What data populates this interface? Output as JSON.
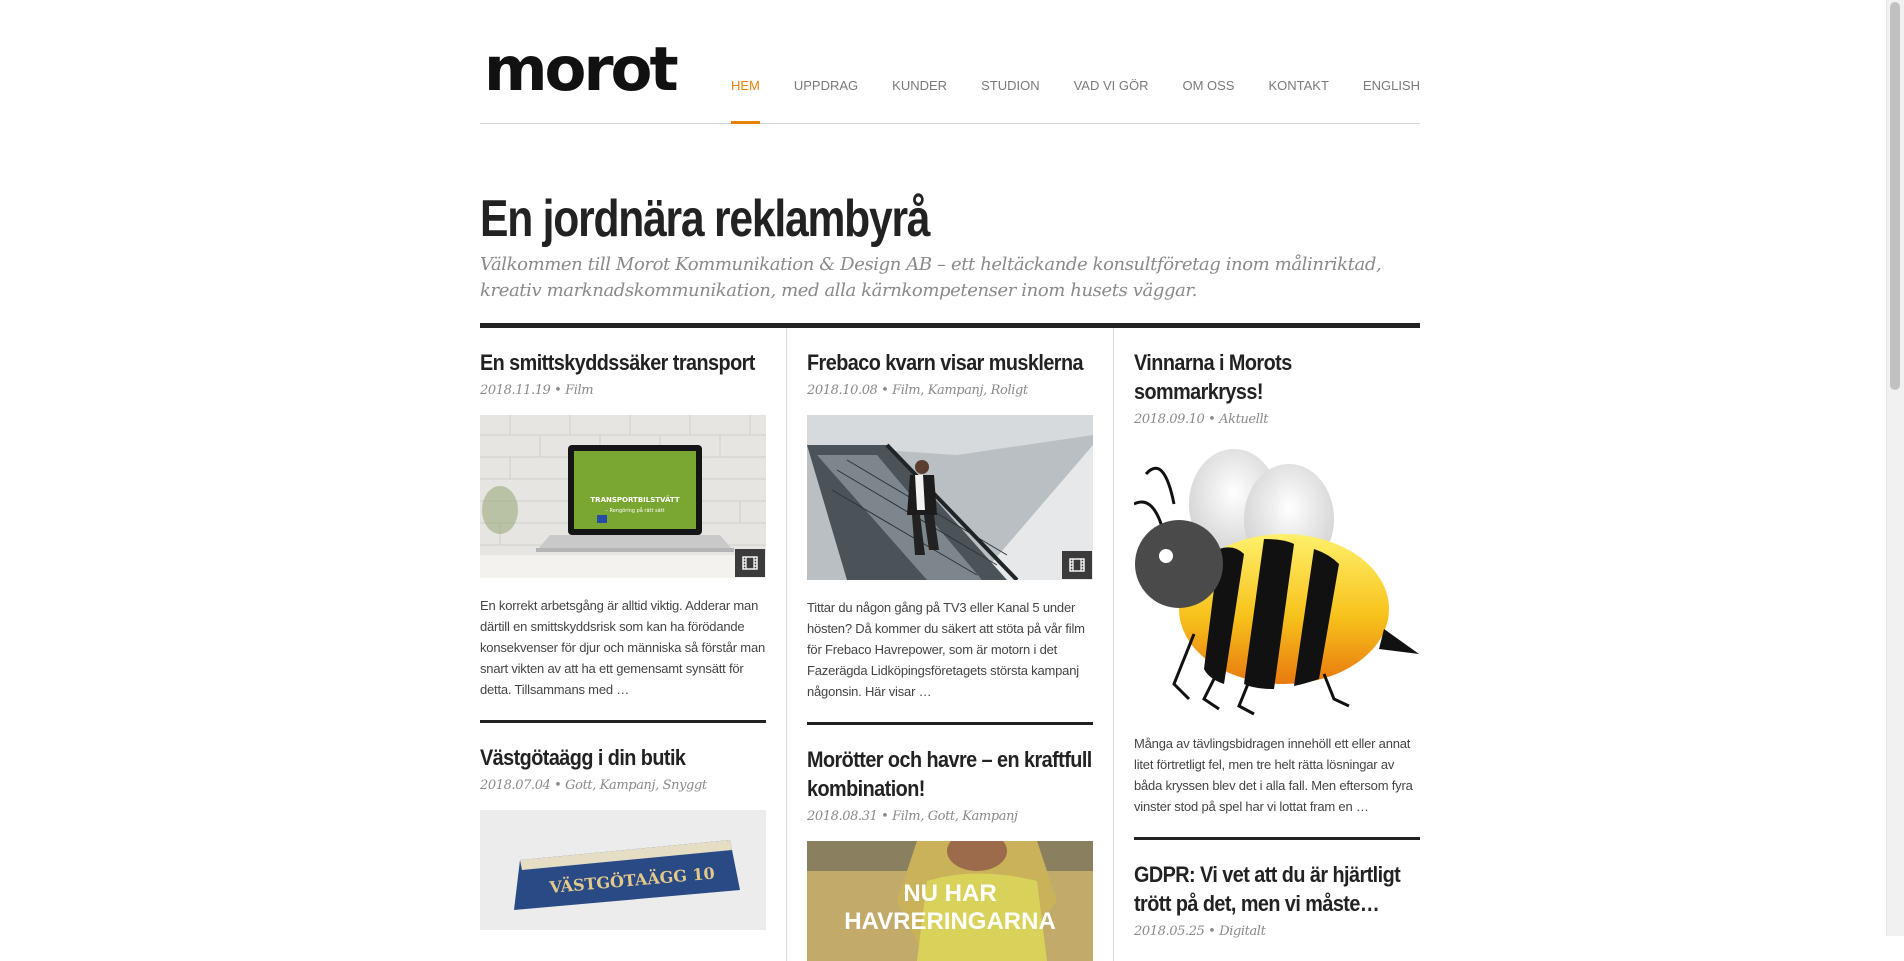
{
  "site": {
    "logo_text": "morot"
  },
  "nav": {
    "items": [
      {
        "label": "HEM",
        "active": true
      },
      {
        "label": "UPPDRAG",
        "active": false
      },
      {
        "label": "KUNDER",
        "active": false
      },
      {
        "label": "STUDION",
        "active": false
      },
      {
        "label": "VAD VI GÖR",
        "active": false
      },
      {
        "label": "OM OSS",
        "active": false
      },
      {
        "label": "KONTAKT",
        "active": false
      },
      {
        "label": "ENGLISH",
        "active": false
      }
    ],
    "accent_color": "#e8800c"
  },
  "hero": {
    "title": "En jordnära reklambyrå",
    "intro": "Välkommen till Morot Kommunikation & Design AB – ett heltäckande konsultföretag inom målinriktad, kreativ marknadskommunikation, med alla kärnkompetenser inom husets väggar."
  },
  "columns": [
    {
      "posts": [
        {
          "title": "En smittskyddssäker transport",
          "date": "2018.11.19",
          "categories": "Film",
          "has_video": true,
          "image_text": {
            "line1": "TRANSPORTBILSTVÄTT",
            "line2": "– Rengöring på rätt sätt"
          },
          "excerpt": "En korrekt arbetsgång är alltid viktig. Adderar man därtill en smittskyddsrisk som kan ha förödande konsekvenser för djur och människa så förstår man snart vikten av att ha ett gemensamt synsätt för detta. Tillsammans med …"
        },
        {
          "title": "Västgötaägg i din butik",
          "date": "2018.07.04",
          "categories": "Gott, Kampanj, Snyggt",
          "has_video": false,
          "image_text": {
            "line1": "VÄSTGÖTAÄGG 10"
          }
        }
      ]
    },
    {
      "posts": [
        {
          "title": "Frebaco kvarn visar musklerna",
          "date": "2018.10.08",
          "categories": "Film, Kampanj, Roligt",
          "has_video": true,
          "excerpt": "Tittar du någon gång på TV3 eller Kanal 5 under hösten? Då kommer du säkert att stöta på vår film för Frebaco Havrepower, som är motorn i det Fazerägda Lidköpingsföretagets största kampanj någonsin. Här visar …"
        },
        {
          "title": "Morötter och havre – en kraftfull kombination!",
          "date": "2018.08.31",
          "categories": "Film, Gott, Kampanj",
          "has_video": false,
          "image_text": {
            "line1": "NU HAR",
            "line2": "HAVRERINGARNA"
          }
        }
      ]
    },
    {
      "posts": [
        {
          "title": "Vinnarna i Morots sommarkryss!",
          "date": "2018.09.10",
          "categories": "Aktuellt",
          "has_video": false,
          "excerpt": "Många av tävlingsbidragen innehöll ett eller annat litet förtretligt fel, men tre helt rätta lösningar av båda kryssen blev det i alla fall. Men eftersom fyra vinster stod på spel har vi lottat fram en …"
        },
        {
          "title": "GDPR: Vi vet att du är hjärtligt trött på det, men vi måste…",
          "date": "2018.05.25",
          "categories": "Digitalt",
          "has_video": false
        }
      ]
    }
  ],
  "meta_separator": " • ",
  "icons": {
    "video": "film-icon"
  }
}
